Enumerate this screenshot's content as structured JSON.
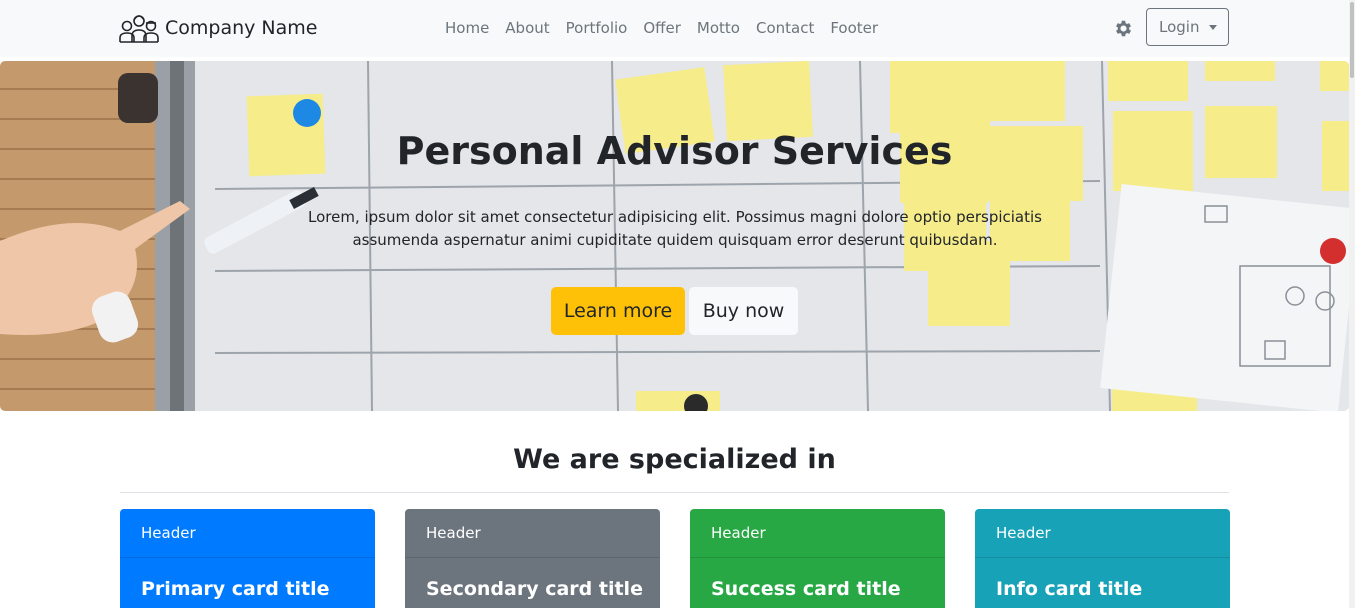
{
  "brand": {
    "name": "Company Name",
    "logo_icon": "team-people-icon"
  },
  "nav": {
    "links": [
      "Home",
      "About",
      "Portfolio",
      "Offer",
      "Motto",
      "Contact",
      "Footer"
    ],
    "settings_icon": "gear-icon",
    "login_label": "Login"
  },
  "hero": {
    "title": "Personal Advisor Services",
    "text": "Lorem, ipsum dolor sit amet consectetur adipisicing elit. Possimus magni dolore optio perspiciatis assumenda aspernatur animi cupiditate quidem quisquam error deserunt quibusdam.",
    "primary_button": "Learn more",
    "secondary_button": "Buy now",
    "background": "whiteboard-sticky-notes-photo"
  },
  "section": {
    "title": "We are specialized in",
    "cards": [
      {
        "header": "Header",
        "title": "Primary card title",
        "color": "#007bff"
      },
      {
        "header": "Header",
        "title": "Secondary card title",
        "color": "#6c757d"
      },
      {
        "header": "Header",
        "title": "Success card title",
        "color": "#28a745"
      },
      {
        "header": "Header",
        "title": "Info card title",
        "color": "#17a2b8"
      }
    ]
  },
  "colors": {
    "navbar_bg": "#f8f9fa",
    "warning": "#ffc107",
    "light": "#f8f9fa",
    "muted": "#6c757d"
  }
}
